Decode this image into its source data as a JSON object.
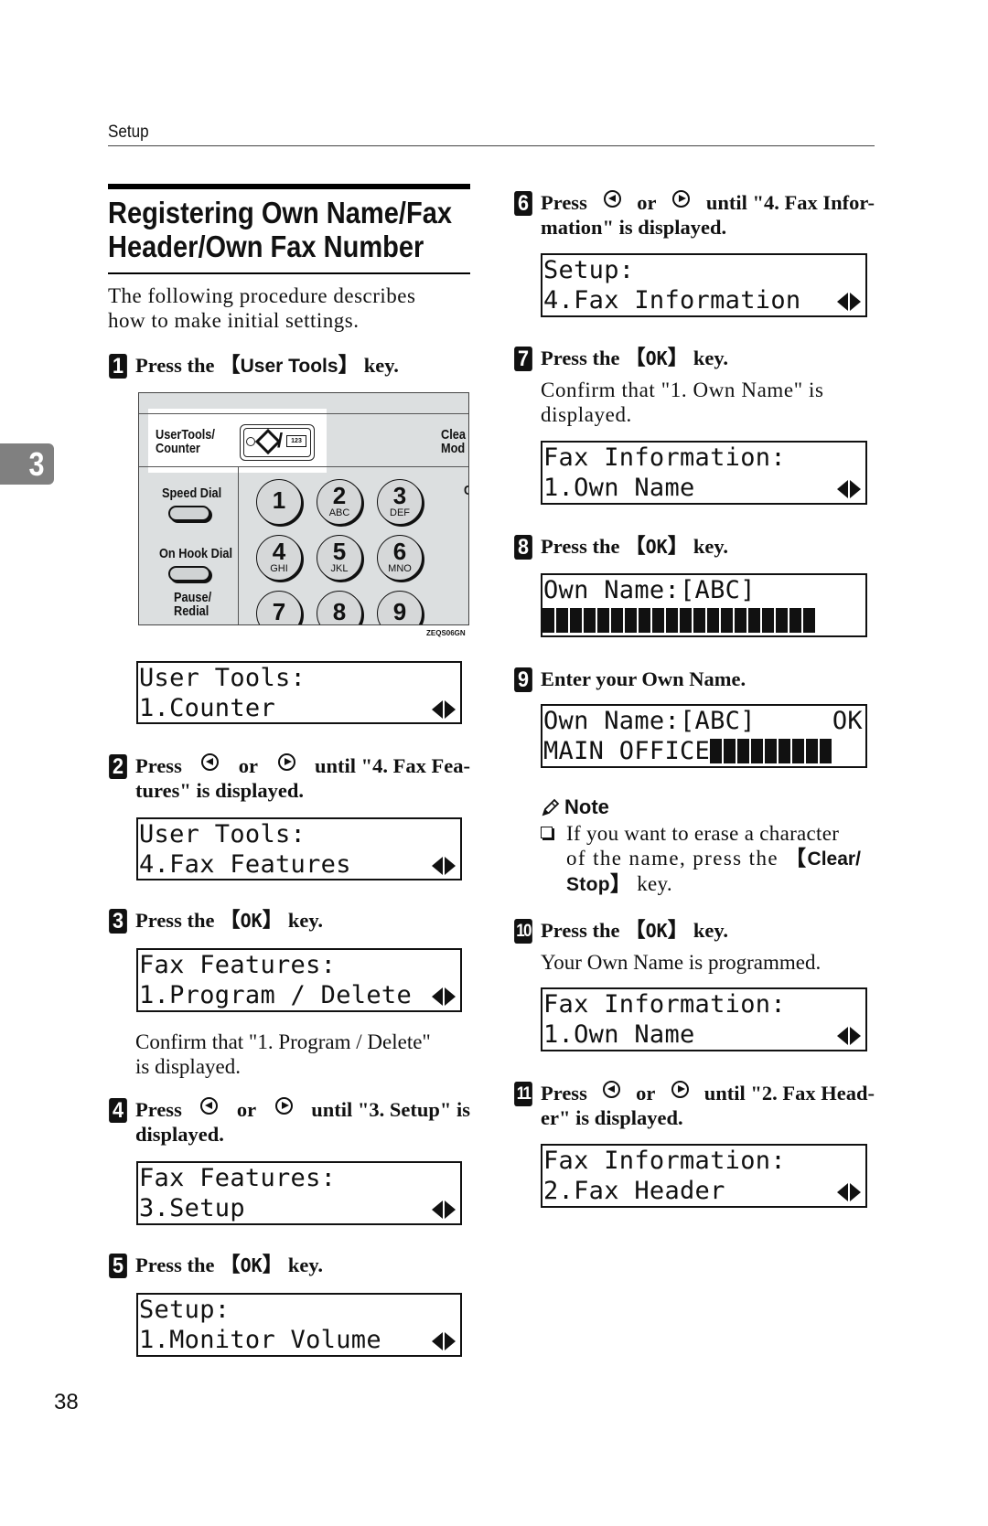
{
  "running_head": "Setup",
  "chapter_tab": "3",
  "section_title_line1": "Registering Own Name/Fax",
  "section_title_line2": "Header/Own Fax Number",
  "intro_line1": "The following procedure describes",
  "intro_line2": "how to make initial settings.",
  "page_number": "38",
  "panel": {
    "user_tools_label_1": "UserTools/",
    "user_tools_label_2": "Counter",
    "counter_key_text": "123",
    "clear_label_1": "Clea",
    "clear_label_2": "Mod",
    "edge_letter": "C",
    "speed_dial": "Speed Dial",
    "on_hook_dial": "On Hook Dial",
    "pause_1": "Pause/",
    "pause_2": "Redial",
    "keys": [
      {
        "n": "1",
        "s": ""
      },
      {
        "n": "2",
        "s": "ABC"
      },
      {
        "n": "3",
        "s": "DEF"
      },
      {
        "n": "4",
        "s": "GHI"
      },
      {
        "n": "5",
        "s": "JKL"
      },
      {
        "n": "6",
        "s": "MNO"
      },
      {
        "n": "7",
        "s": ""
      },
      {
        "n": "8",
        "s": ""
      },
      {
        "n": "9",
        "s": ""
      }
    ],
    "figure_code": "ZEQS06GN"
  },
  "steps": {
    "s1": {
      "num": "1",
      "pre": "Press the ",
      "key": "User Tools",
      "post": " key."
    },
    "s2": {
      "num": "2",
      "pre": "Press",
      "or": "or",
      "post1": "until \"4. Fax Fea-",
      "post2": "tures\" is displayed."
    },
    "s3": {
      "num": "3",
      "pre": "Press the ",
      "key": "OK",
      "post": " key.",
      "confirm1": "Confirm that \"1. Program / Delete\"",
      "confirm2": "is displayed."
    },
    "s4": {
      "num": "4",
      "pre": "Press",
      "or": "or",
      "post1": "until \"3. Setup\" is",
      "post2": "displayed."
    },
    "s5": {
      "num": "5",
      "pre": "Press the ",
      "key": "OK",
      "post": " key."
    },
    "s6": {
      "num": "6",
      "pre": "Press",
      "or": "or",
      "post1": "until \"4. Fax Infor-",
      "post2": "mation\" is displayed."
    },
    "s7": {
      "num": "7",
      "pre": "Press the ",
      "key": "OK",
      "post": " key.",
      "confirm1": "Confirm that \"1. Own Name\" is",
      "confirm2": "displayed."
    },
    "s8": {
      "num": "8",
      "pre": "Press the ",
      "key": "OK",
      "post": " key."
    },
    "s9": {
      "num": "9",
      "text": "Enter your Own Name."
    },
    "s10": {
      "num": "10",
      "pre": "Press the ",
      "key": "OK",
      "post": " key.",
      "result": "Your Own Name is programmed."
    },
    "s11": {
      "num": "11",
      "pre": "Press",
      "or": "or",
      "post1": "until \"2. Fax Head-",
      "post2": "er\" is displayed."
    }
  },
  "note": {
    "title": "Note",
    "line1": "If you want to erase a character",
    "line2": "of the name, press the ",
    "key1": "Clear/",
    "key2": "Stop",
    "line3": " key."
  },
  "lcd": {
    "d1": {
      "line1": "User Tools:",
      "line2": "1.Counter"
    },
    "d2": {
      "line1": "User Tools:",
      "line2": "4.Fax Features"
    },
    "d3": {
      "line1": "Fax Features:",
      "line2": "1.Program / Delete"
    },
    "d4": {
      "line1": "Fax Features:",
      "line2": "3.Setup"
    },
    "d5": {
      "line1": "Setup:",
      "line2": "1.Monitor Volume"
    },
    "d6": {
      "line1": "Setup:",
      "line2": "4.Fax Information"
    },
    "d7": {
      "line1": "Fax Information:",
      "line2": "1.Own Name"
    },
    "d8": {
      "line1": "Own Name:[ABC]",
      "line2": "",
      "blocks": 20
    },
    "d9": {
      "line1": "Own Name:[ABC]",
      "ok": "OK",
      "line2": "MAIN OFFICE",
      "blocks": 9
    },
    "d10": {
      "line1": "Fax Information:",
      "line2": "1.Own Name"
    },
    "d11": {
      "line1": "Fax Information:",
      "line2": "2.Fax Header"
    }
  }
}
